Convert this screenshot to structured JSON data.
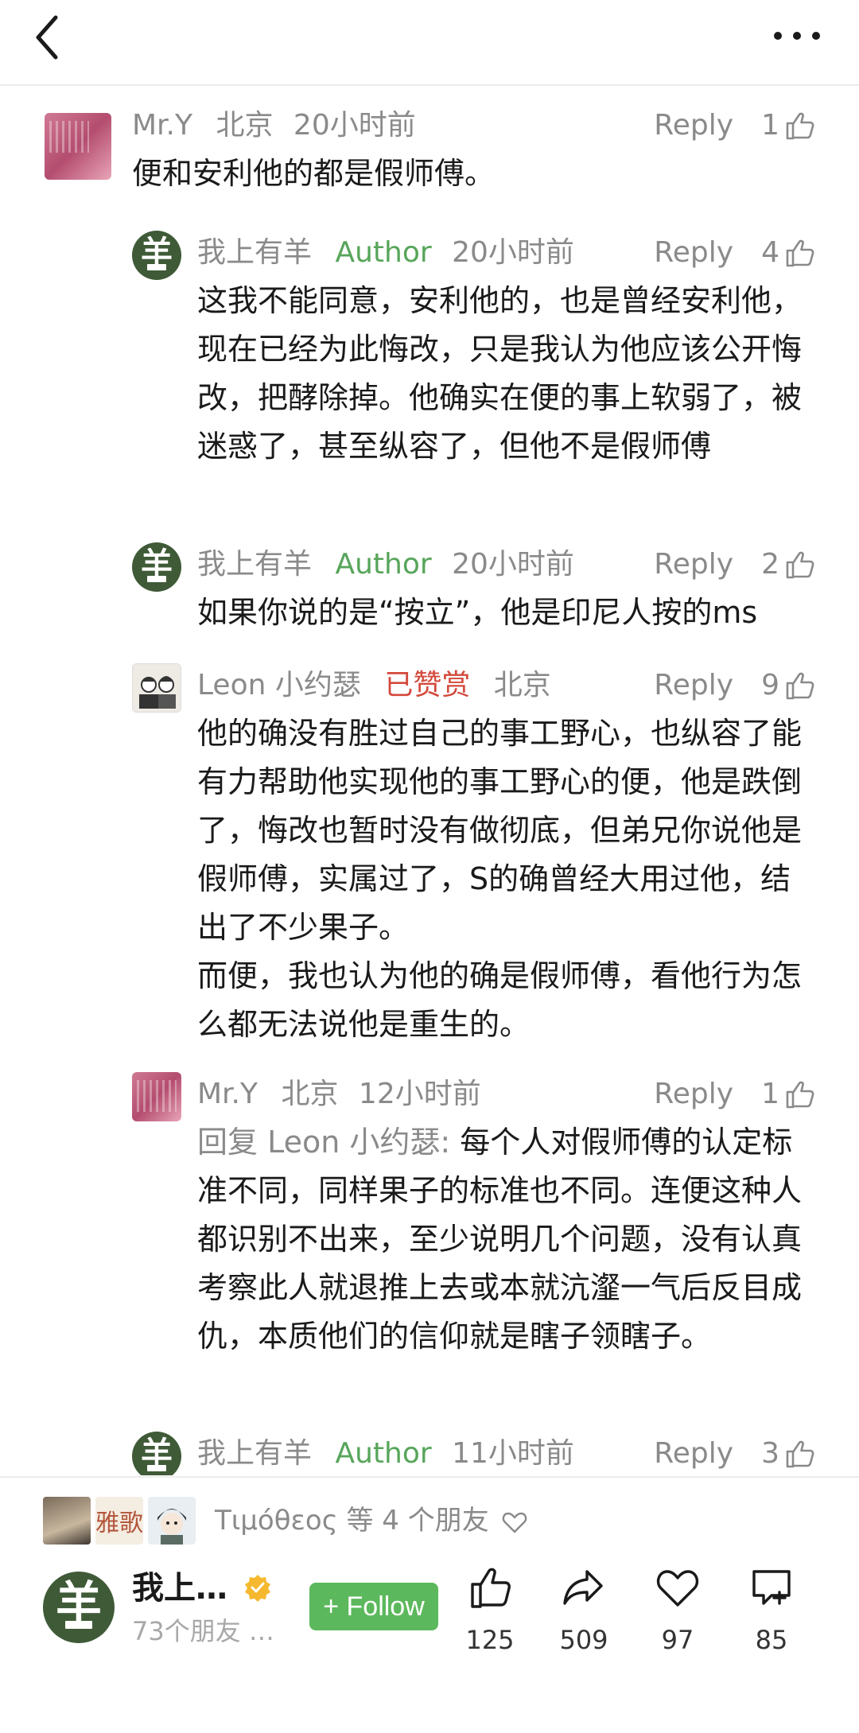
{
  "comments": [
    {
      "user": "Mr.Y",
      "location": "北京",
      "time": "20小时前",
      "reply": "Reply",
      "likes": "1",
      "text": "便和安利他的都是假师傅。"
    },
    {
      "user": "我上有羊",
      "badge": "Author",
      "time": "20小时前",
      "reply": "Reply",
      "likes": "4",
      "text": "这我不能同意，安利他的，也是曾经安利他，现在已经为此悔改，只是我认为他应该公开悔改，把酵除掉。他确实在便的事上软弱了，被迷惑了，甚至纵容了，但他不是假师傅"
    },
    {
      "user": "我上有羊",
      "badge": "Author",
      "time": "20小时前",
      "reply": "Reply",
      "likes": "2",
      "text": "如果你说的是“按立”，他是印尼人按的ms"
    },
    {
      "user": "Leon 小约瑟",
      "reward": "已赞赏",
      "location": "北京",
      "reply": "Reply",
      "likes": "9",
      "text_lines": [
        "他的确没有胜过自己的事工野心，也纵容了能有力帮助他实现他的事工野心的便，他是跌倒了，悔改也暂时没有做彻底，但弟兄你说他是假师傅，实属过了，S的确曾经大用过他，结出了不少果子。",
        "而便，我也认为他的确是假师傅，看他行为怎么都无法说他是重生的。"
      ]
    },
    {
      "user": "Mr.Y",
      "location": "北京",
      "time": "12小时前",
      "reply": "Reply",
      "likes": "1",
      "reply_prefix": "回复 Leon 小约瑟:",
      "text": " 每个人对假师傅的认定标准不同，同样果子的标准也不同。连便这种人都识别不出来，至少说明几个问题，没有认真考察此人就退推上去或本就沆瀣一气后反目成仇，本质他们的信仰就是瞎子领瞎子。"
    },
    {
      "user": "我上有羊",
      "badge": "Author",
      "time": "11小时前",
      "reply": "Reply",
      "likes": "3"
    }
  ],
  "avatar_glyph": "羊",
  "friends": {
    "text": "Τιμόθεος 等 4 个朋友",
    "avatar2_text": "雅歌"
  },
  "bottom": {
    "name": "我上…",
    "sub": "73个朋友 …",
    "follow_label": "+ Follow",
    "like_count": "125",
    "share_count": "509",
    "fav_count": "97",
    "comment_count": "85"
  },
  "colors": {
    "author": "#57a55a",
    "reward": "#d34a3c",
    "follow": "#5cb85c",
    "muted": "#8a8a8a"
  },
  "icons": [
    "back-icon",
    "more-icon",
    "thumb-up-icon",
    "heart-icon",
    "share-icon",
    "comment-icon",
    "verified-icon"
  ]
}
